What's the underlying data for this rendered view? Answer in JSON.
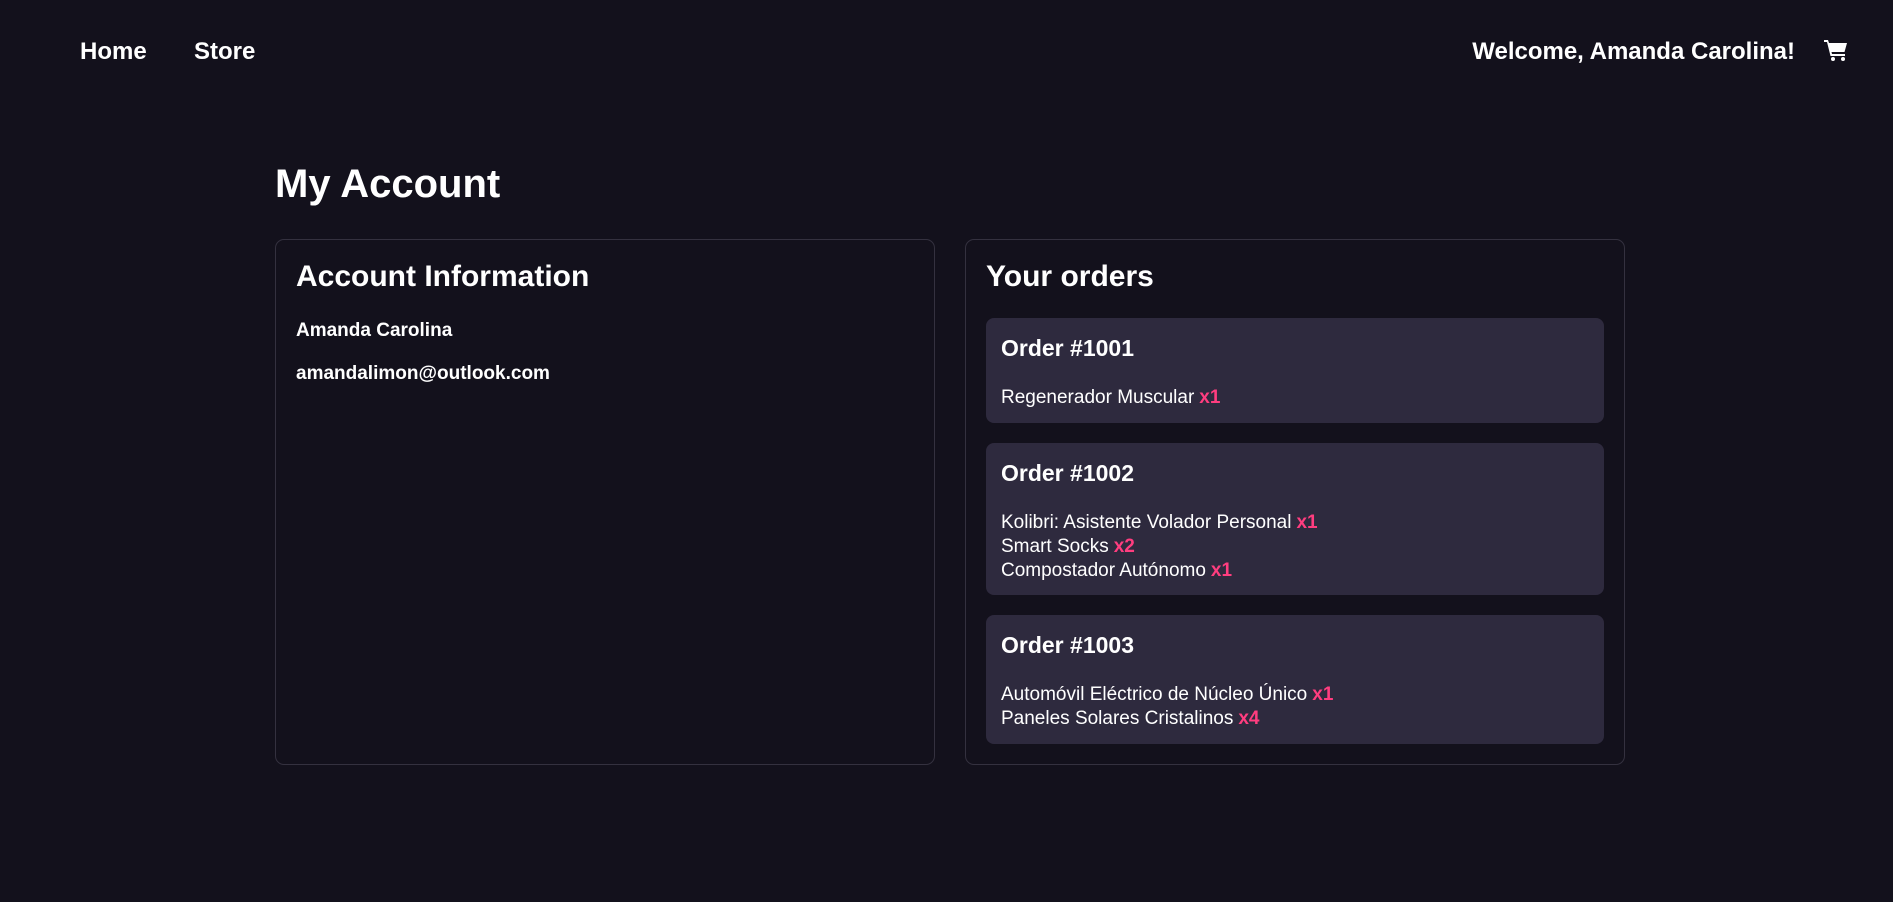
{
  "nav": {
    "home_label": "Home",
    "store_label": "Store",
    "welcome_text": "Welcome, Amanda Carolina!",
    "cart_icon": "shopping-cart-icon"
  },
  "page": {
    "title": "My Account"
  },
  "account": {
    "title": "Account Information",
    "name": "Amanda Carolina",
    "email": "amandalimon@outlook.com"
  },
  "orders": {
    "title": "Your orders",
    "items": [
      {
        "title": "Order #1001",
        "lines": [
          {
            "product": "Regenerador Muscular",
            "qty": "x1"
          }
        ]
      },
      {
        "title": "Order #1002",
        "lines": [
          {
            "product": "Kolibri: Asistente Volador Personal",
            "qty": "x1"
          },
          {
            "product": "Smart Socks",
            "qty": "x2"
          },
          {
            "product": "Compostador Autónomo",
            "qty": "x1"
          }
        ]
      },
      {
        "title": "Order #1003",
        "lines": [
          {
            "product": "Automóvil Eléctrico de Núcleo Único",
            "qty": "x1"
          },
          {
            "product": "Paneles Solares Cristalinos",
            "qty": "x4"
          }
        ]
      }
    ]
  },
  "colors": {
    "background": "#13111c",
    "card": "#2e2a3e",
    "accent": "#ff3d7f",
    "border": "#34313f"
  }
}
